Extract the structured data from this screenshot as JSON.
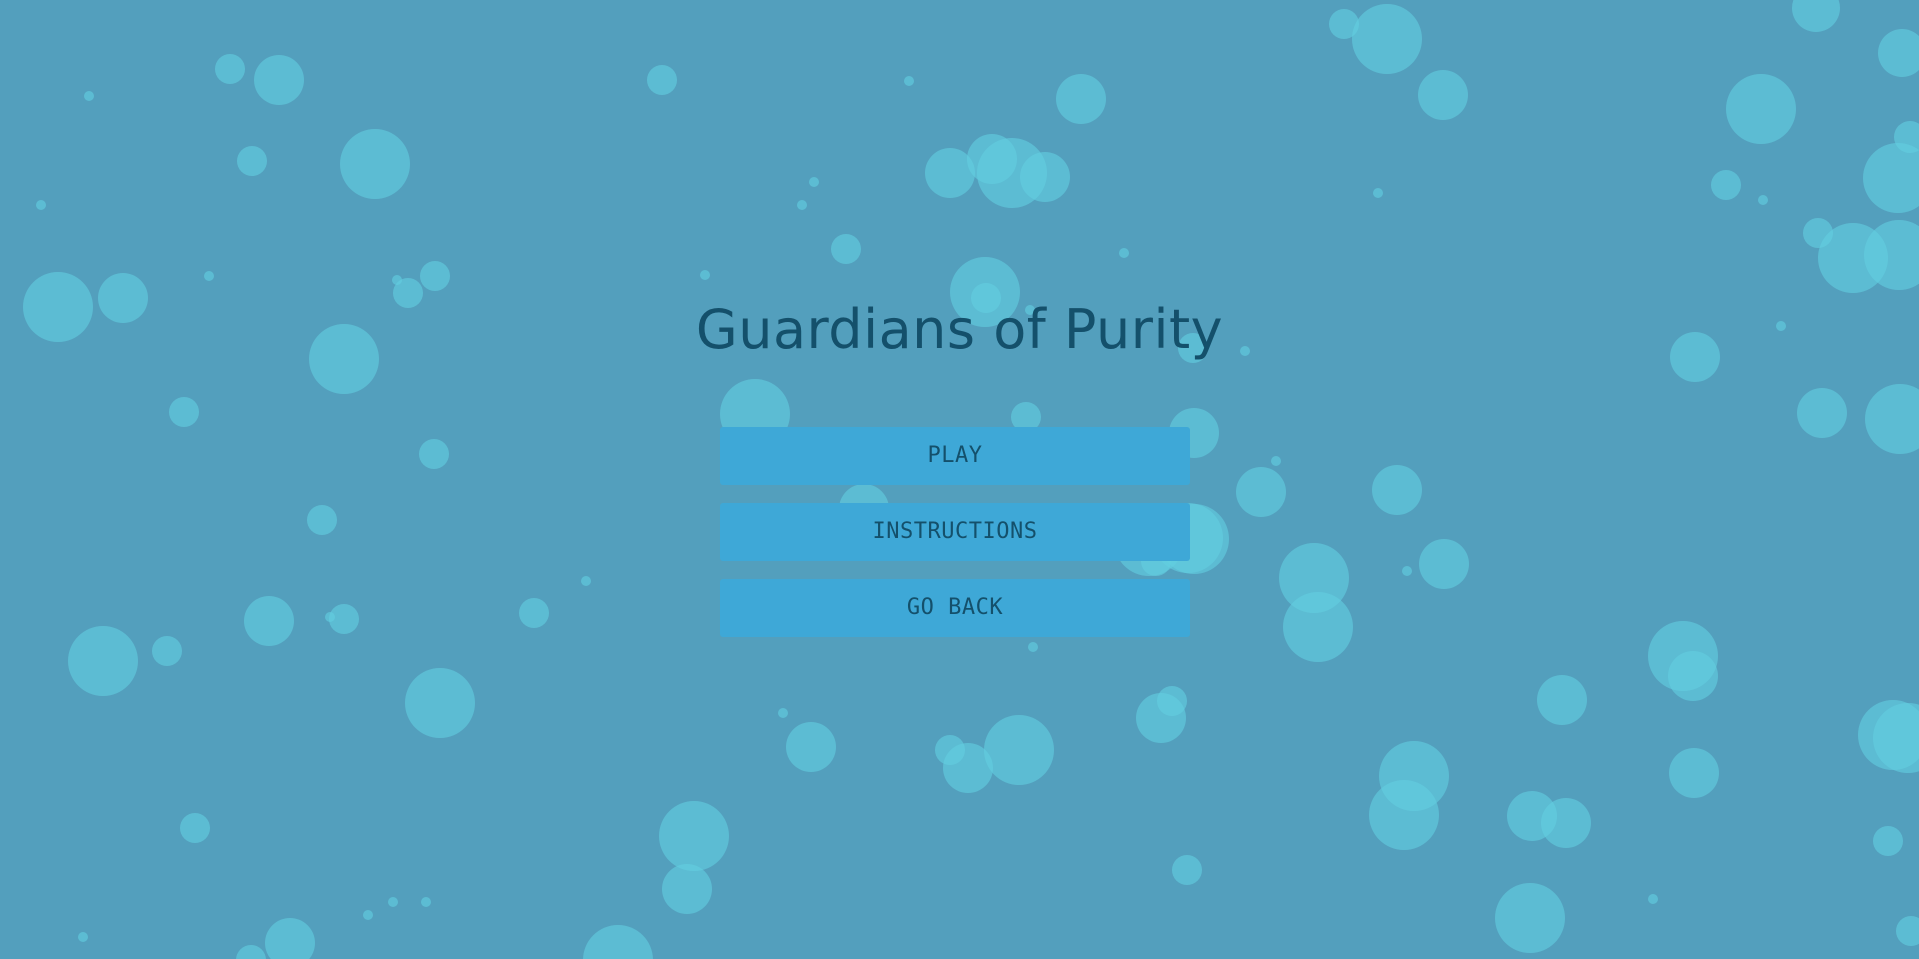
{
  "game": {
    "title": "Guardians of Purity"
  },
  "menu": {
    "play_label": "PLAY",
    "instructions_label": "INSTRUCTIONS",
    "back_label": "GO BACK"
  },
  "colors": {
    "background": "#539fbd",
    "bubble": "#62cee0",
    "button": "#3ea8d7",
    "text": "#14506b"
  }
}
